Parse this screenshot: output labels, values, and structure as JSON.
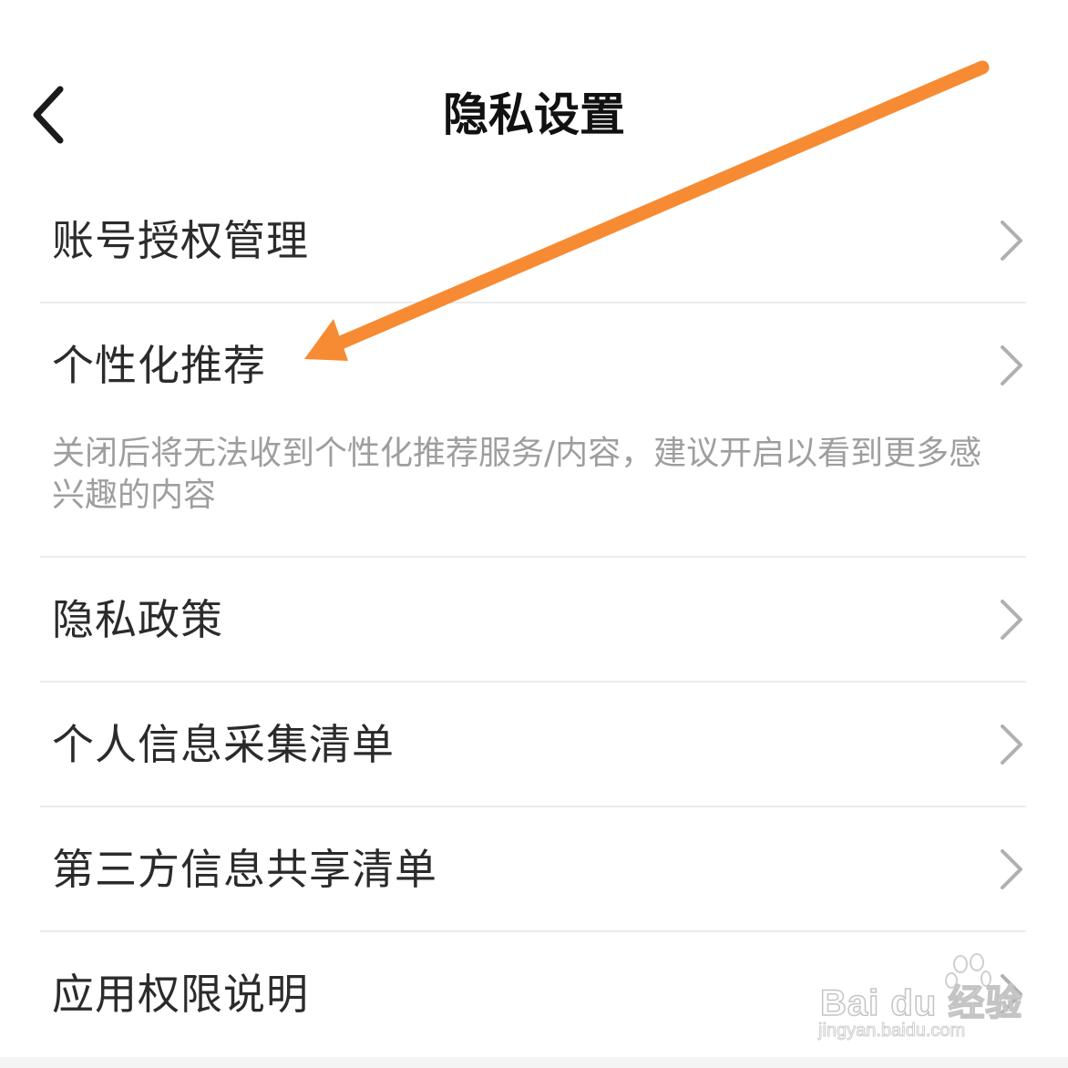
{
  "header": {
    "title": "隐私设置",
    "back_icon": "chevron-left-icon"
  },
  "items": [
    {
      "label": "账号授权管理"
    },
    {
      "label": "个性化推荐",
      "description": "关闭后将无法收到个性化推荐服务/内容，建议开启以看到更多感兴趣的内容"
    },
    {
      "label": "隐私政策"
    },
    {
      "label": "个人信息采集清单"
    },
    {
      "label": "第三方信息共享清单"
    },
    {
      "label": "应用权限说明"
    }
  ],
  "annotation": {
    "arrow_color": "#f68b33"
  },
  "watermark": {
    "brand": "Bai du 经验",
    "url": "jingyan.baidu.com"
  },
  "colors": {
    "title": "#111111",
    "label": "#2b2b2b",
    "description": "#9e9e9e",
    "divider": "#ececec",
    "chevron": "#b0b0b0"
  }
}
